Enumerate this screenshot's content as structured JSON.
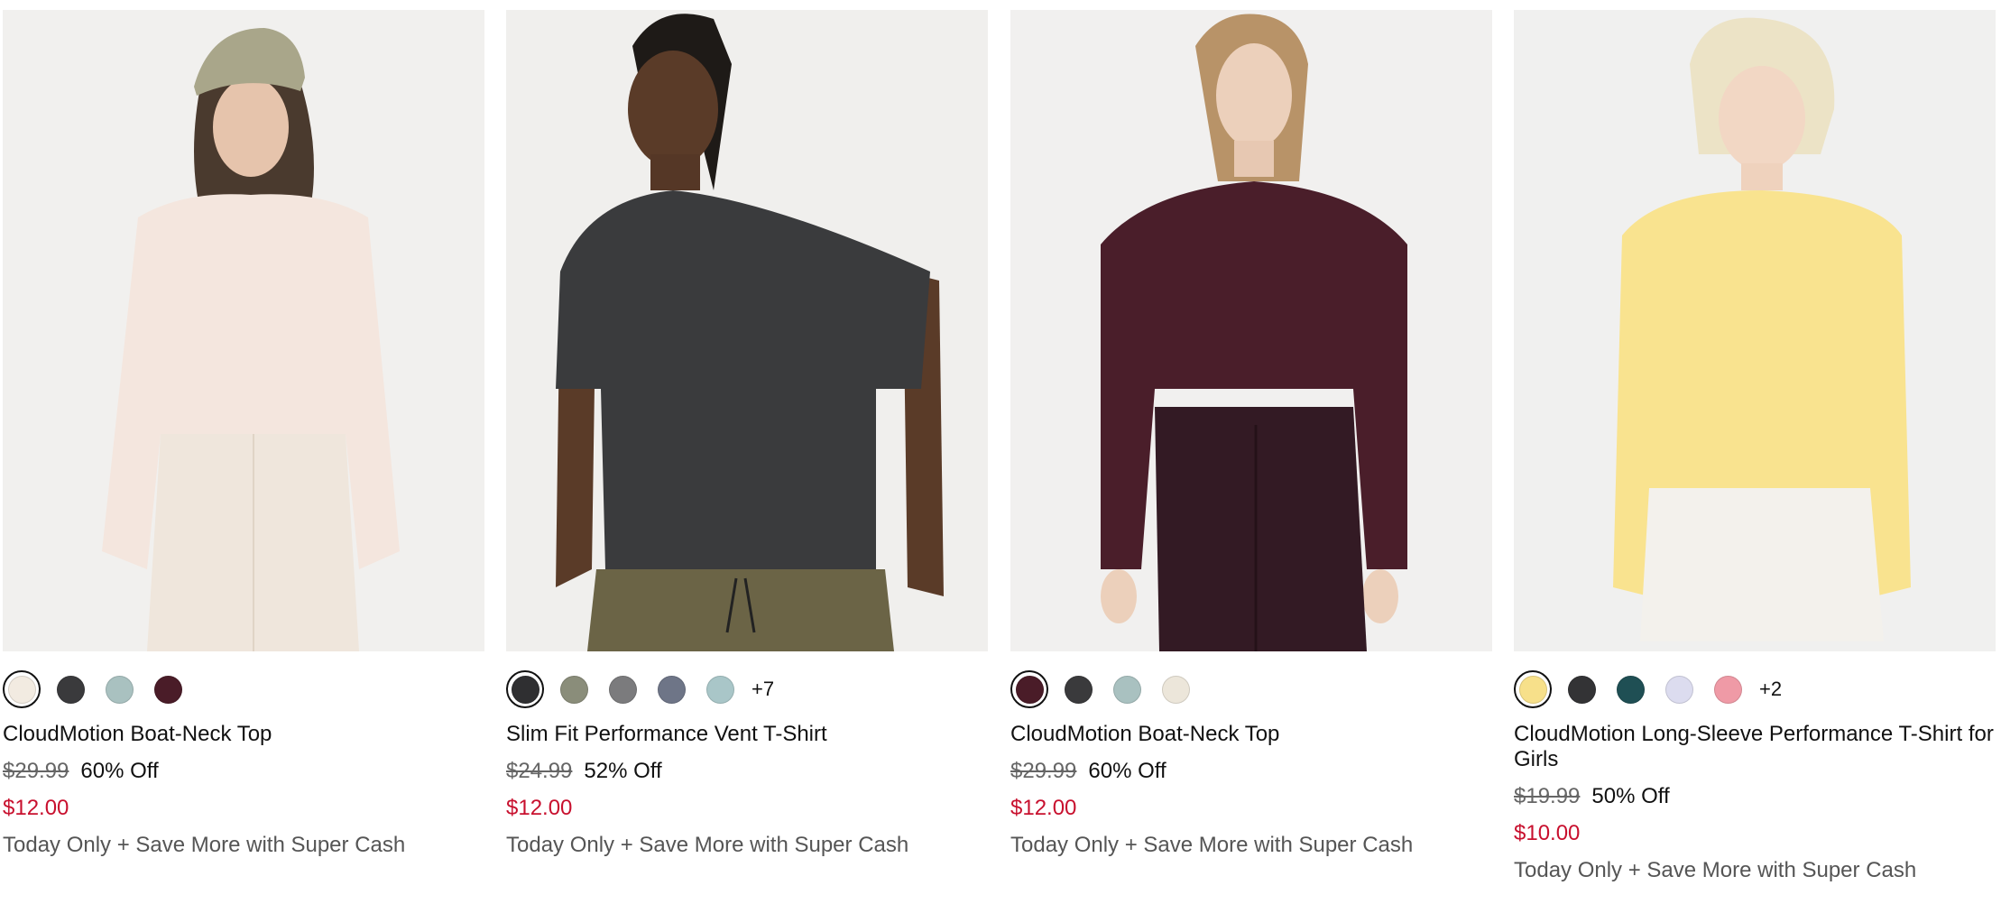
{
  "products": [
    {
      "name": "CloudMotion Boat-Neck Top",
      "original_price": "$29.99",
      "discount": "60% Off",
      "sale_price": "$12.00",
      "promo": "Today Only + Save More with Super Cash",
      "swatches": [
        "#f2ebe1",
        "#3a3a3c",
        "#a9c1c0",
        "#4a1c28"
      ],
      "selected_swatch": 0,
      "more_colors": "",
      "image_icon": "woman-cap-cream-top"
    },
    {
      "name": "Slim Fit Performance Vent T-Shirt",
      "original_price": "$24.99",
      "discount": "52% Off",
      "sale_price": "$12.00",
      "promo": "Today Only + Save More with Super Cash",
      "swatches": [
        "#2f2f31",
        "#8a8d7a",
        "#7b7b7d",
        "#6e7587",
        "#a9c6c8"
      ],
      "selected_swatch": 0,
      "more_colors": "+7",
      "image_icon": "man-charcoal-tshirt"
    },
    {
      "name": "CloudMotion Boat-Neck Top",
      "original_price": "$29.99",
      "discount": "60% Off",
      "sale_price": "$12.00",
      "promo": "Today Only + Save More with Super Cash",
      "swatches": [
        "#4a1c28",
        "#3a3a3c",
        "#a9c1c0",
        "#ece6da"
      ],
      "selected_swatch": 0,
      "more_colors": "",
      "image_icon": "woman-burgundy-top"
    },
    {
      "name": "CloudMotion Long-Sleeve Performance T-Shirt for Girls",
      "original_price": "$19.99",
      "discount": "50% Off",
      "sale_price": "$10.00",
      "promo": "Today Only + Save More with Super Cash",
      "swatches": [
        "#f7e08a",
        "#333335",
        "#1f4f54",
        "#dcdcef",
        "#ef9aa6"
      ],
      "selected_swatch": 0,
      "more_colors": "+2",
      "image_icon": "girl-yellow-longsleeve"
    }
  ],
  "colors": {
    "sale_price": "#c8102e",
    "original_price": "#666666",
    "promo": "#555555"
  }
}
